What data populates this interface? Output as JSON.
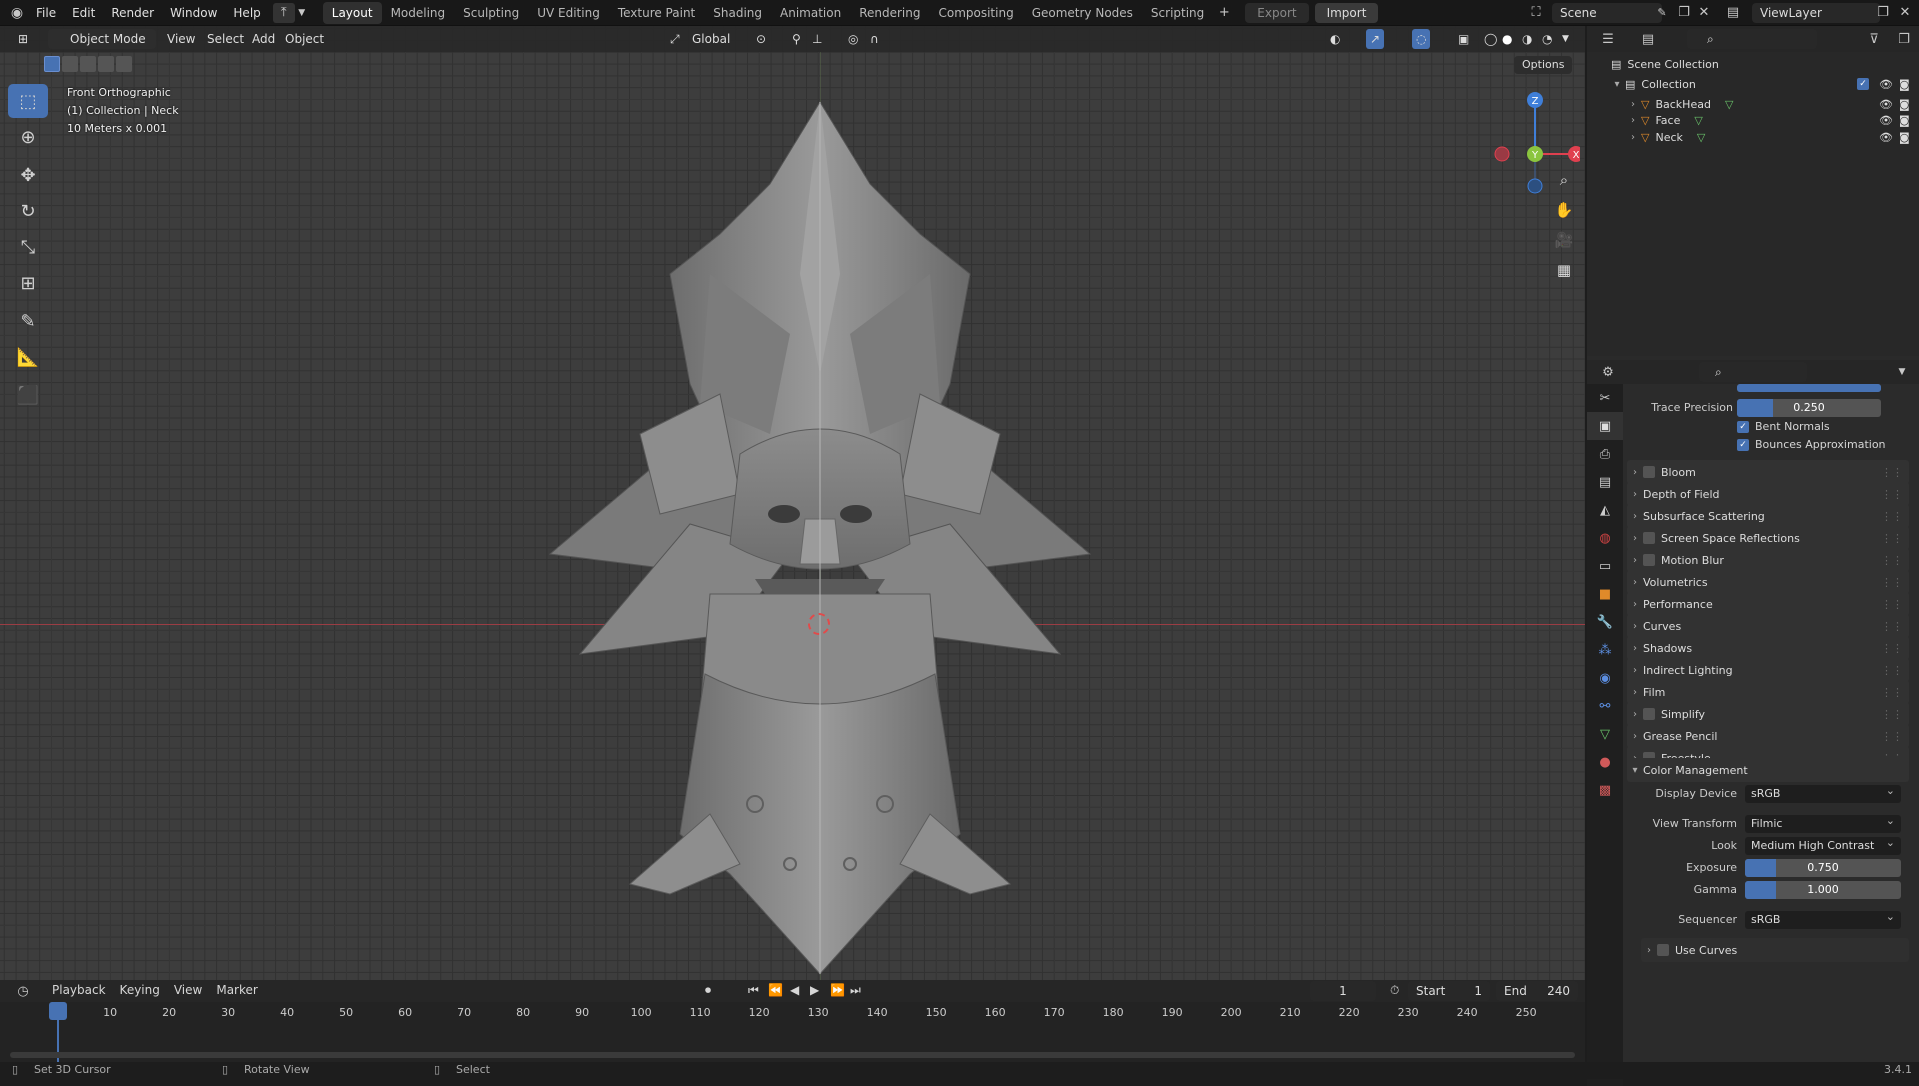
{
  "topbar": {
    "menus": [
      "File",
      "Edit",
      "Render",
      "Window",
      "Help"
    ],
    "workspaces": [
      "Layout",
      "Modeling",
      "Sculpting",
      "UV Editing",
      "Texture Paint",
      "Shading",
      "Animation",
      "Rendering",
      "Compositing",
      "Geometry Nodes",
      "Scripting"
    ],
    "active_workspace": "Layout",
    "export_label": "Export",
    "import_label": "Import",
    "scene": "Scene",
    "view_layer": "ViewLayer"
  },
  "viewport_header": {
    "mode": "Object Mode",
    "menus": [
      "View",
      "Select",
      "Add",
      "Object"
    ],
    "orientation": "Global",
    "options_label": "Options"
  },
  "viewport": {
    "view_name": "Front Orthographic",
    "collection_info": "(1) Collection | Neck",
    "scale_info": "10 Meters x 0.001",
    "gizmo_axes": {
      "z": "Z",
      "y": "Y",
      "x": "X"
    }
  },
  "outliner": {
    "scene_collection": "Scene Collection",
    "collection": "Collection",
    "objects": [
      "BackHead",
      "Face",
      "Neck"
    ]
  },
  "properties": {
    "trace_precision_label": "Trace Precision",
    "trace_precision_value": "0.250",
    "trace_precision_fraction": 0.25,
    "bent_normals": "Bent Normals",
    "bounces_approx": "Bounces Approximation",
    "panels": [
      {
        "label": "Bloom",
        "checkbox": true
      },
      {
        "label": "Depth of Field",
        "checkbox": false
      },
      {
        "label": "Subsurface Scattering",
        "checkbox": false
      },
      {
        "label": "Screen Space Reflections",
        "checkbox": true
      },
      {
        "label": "Motion Blur",
        "checkbox": true
      },
      {
        "label": "Volumetrics",
        "checkbox": false
      },
      {
        "label": "Performance",
        "checkbox": false
      },
      {
        "label": "Curves",
        "checkbox": false
      },
      {
        "label": "Shadows",
        "checkbox": false
      },
      {
        "label": "Indirect Lighting",
        "checkbox": false
      },
      {
        "label": "Film",
        "checkbox": false
      },
      {
        "label": "Simplify",
        "checkbox": true
      },
      {
        "label": "Grease Pencil",
        "checkbox": false
      },
      {
        "label": "Freestyle",
        "checkbox": true
      }
    ],
    "color_management": {
      "title": "Color Management",
      "display_device_label": "Display Device",
      "display_device": "sRGB",
      "view_transform_label": "View Transform",
      "view_transform": "Filmic",
      "look_label": "Look",
      "look": "Medium High Contrast",
      "exposure_label": "Exposure",
      "exposure": "0.750",
      "exposure_fraction": 0.2,
      "gamma_label": "Gamma",
      "gamma": "1.000",
      "gamma_fraction": 0.2,
      "sequencer_label": "Sequencer",
      "sequencer": "sRGB",
      "use_curves": "Use Curves"
    }
  },
  "timeline": {
    "menus": [
      "Playback",
      "Keying",
      "View",
      "Marker"
    ],
    "current_frame": "1",
    "start_label": "Start",
    "start": "1",
    "end_label": "End",
    "end": "240",
    "ticks": [
      "1",
      "10",
      "20",
      "30",
      "40",
      "50",
      "60",
      "70",
      "80",
      "90",
      "100",
      "110",
      "120",
      "130",
      "140",
      "150",
      "160",
      "170",
      "180",
      "190",
      "200",
      "210",
      "220",
      "230",
      "240",
      "250"
    ]
  },
  "statusbar": {
    "set_cursor": "Set 3D Cursor",
    "rotate": "Rotate View",
    "select": "Select",
    "version": "3.4.1"
  },
  "colors": {
    "accent": "#4772b3",
    "x_axis": "#e0404f",
    "y_axis": "#8bc53f",
    "z_axis": "#3f7fd9"
  }
}
